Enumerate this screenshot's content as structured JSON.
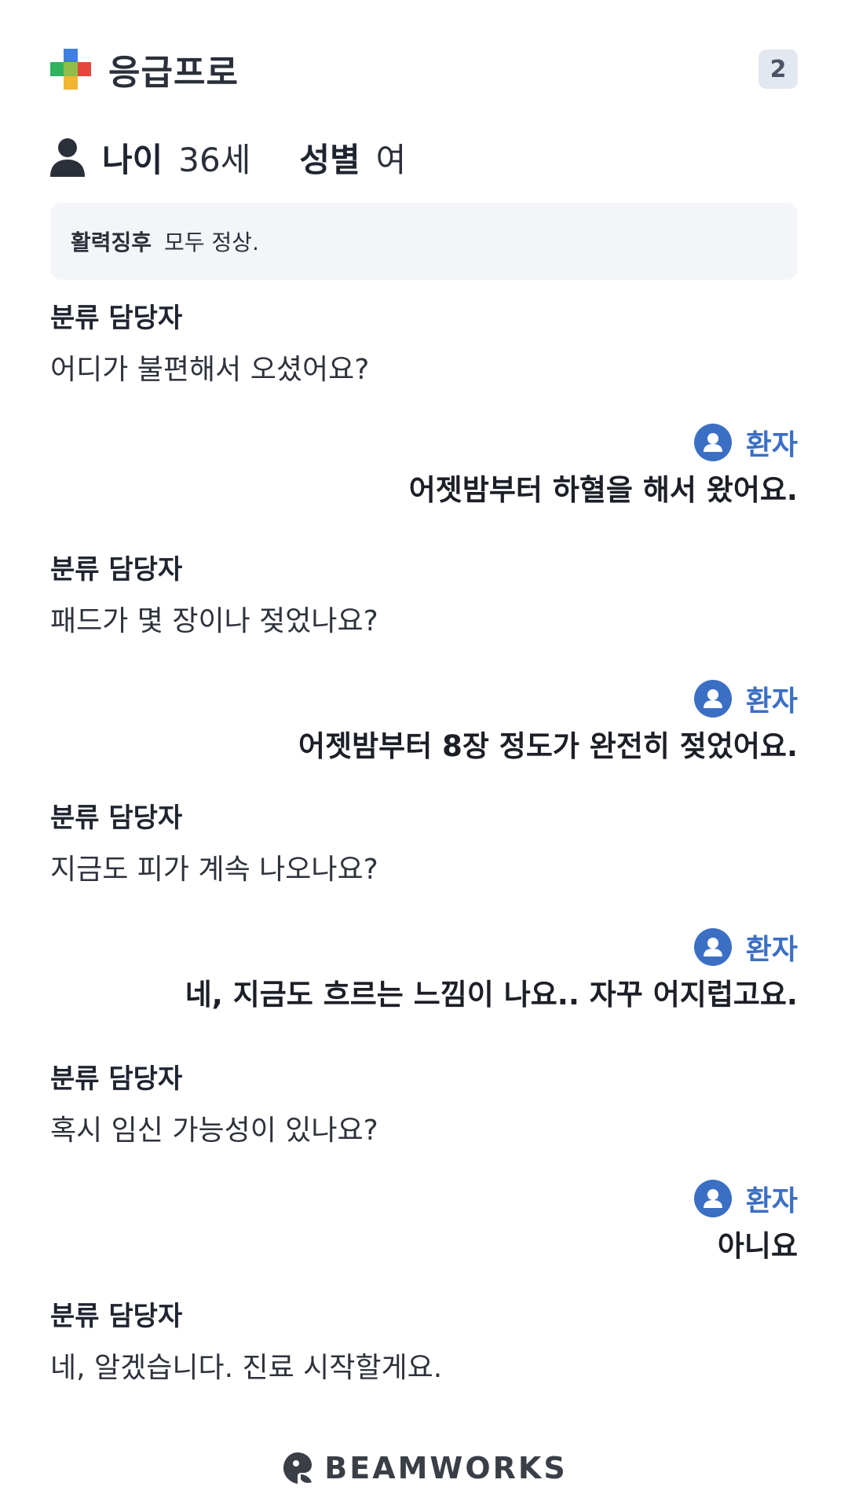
{
  "header": {
    "app_name": "응급프로",
    "logo_icon": "medical-cross-icon",
    "badge_count": "2"
  },
  "patient": {
    "icon": "person-icon",
    "age_label": "나이",
    "age_value": "36세",
    "sex_label": "성별",
    "sex_value": "여"
  },
  "vitals": {
    "label": "활력징후",
    "value": "모두 정상."
  },
  "conversation": [
    {
      "speaker": "분류 담당자",
      "text": "어디가 불편해서 오셨어요?"
    },
    {
      "speaker": "환자",
      "text": "어젯밤부터 하혈을 해서 왔어요."
    },
    {
      "speaker": "분류 담당자",
      "text": "패드가 몇 장이나 젖었나요?"
    },
    {
      "speaker": "환자",
      "text": "어젯밤부터 8장 정도가 완전히 젖었어요."
    },
    {
      "speaker": "분류 담당자",
      "text": "지금도 피가 계속 나오나요?"
    },
    {
      "speaker": "환자",
      "text": "네, 지금도 흐르는 느낌이 나요.. 자꾸 어지럽고요."
    },
    {
      "speaker": "분류 담당자",
      "text": "혹시 임신 가능성이 있나요?"
    },
    {
      "speaker": "환자",
      "text": "아니요"
    },
    {
      "speaker": "분류 담당자",
      "text": "네, 알겠습니다. 진료 시작할게요."
    }
  ],
  "footer": {
    "brand": "BEAMWORKS",
    "logo_icon": "beamworks-logo-icon"
  },
  "colors": {
    "patient_accent": "#3b6fc4",
    "vitals_bg": "#f3f5f8",
    "badge_bg": "#e3e7ef"
  }
}
